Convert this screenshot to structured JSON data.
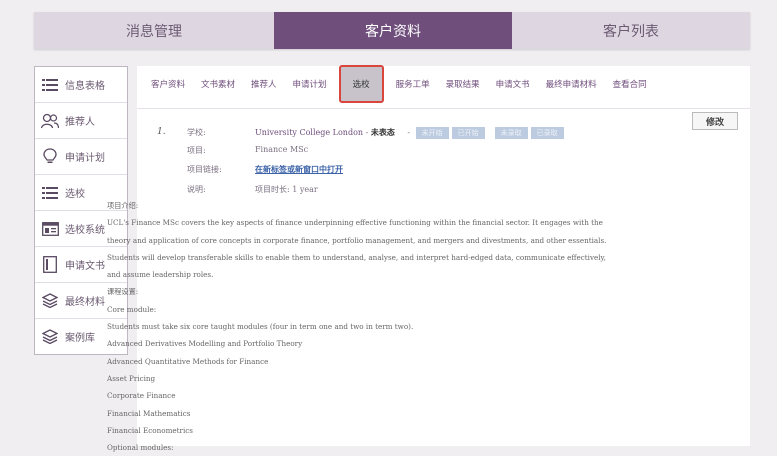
{
  "topnav": {
    "tabs": [
      "消息管理",
      "客户资料",
      "客户列表"
    ]
  },
  "sidebar": {
    "items": [
      {
        "label": "信息表格",
        "icon": "list-icon"
      },
      {
        "label": "推荐人",
        "icon": "users-icon"
      },
      {
        "label": "申请计划",
        "icon": "bulb-icon"
      },
      {
        "label": "选校",
        "icon": "list-icon"
      },
      {
        "label": "选校系统",
        "icon": "window-icon"
      },
      {
        "label": "申请文书",
        "icon": "document-icon"
      },
      {
        "label": "最终材料",
        "icon": "layers-icon"
      },
      {
        "label": "案例库",
        "icon": "layers-icon"
      }
    ]
  },
  "subtabs": [
    "客户资料",
    "文书素材",
    "推荐人",
    "申请计划",
    "选校",
    "服务工单",
    "录取结果",
    "申请文书",
    "最终申请材料",
    "查看合同"
  ],
  "edit_label": "修改",
  "record": {
    "num": "1.",
    "school_label": "学校:",
    "school_name": "University College London",
    "school_sep": " - ",
    "status_main": "未表态",
    "status_dash": "-",
    "chips": [
      "未开始",
      "已开始",
      "未录取",
      "已录取"
    ],
    "program_label": "项目:",
    "program": "Finance MSc",
    "link_label": "项目链接:",
    "link_text": "在新标签或新窗口中打开",
    "note_label": "说明:",
    "duration": "项目时长: 1 year"
  },
  "description": [
    "项目介绍:",
    "UCL's Finance MSc covers the key aspects of finance underpinning effective functioning within the financial sector. It engages with the",
    "theory and application of core concepts in corporate finance, portfolio management, and mergers and divestments, and other essentials.",
    "Students will develop transferable skills to enable them to understand, analyse, and interpret hard-edged data, communicate effectively,",
    "and assume leadership roles.",
    "课程设置:",
    "Core module:",
    "Students must take six core taught modules (four in term one and two in term two).",
    "Advanced Derivatives Modelling and Portfolio Theory",
    "Advanced Quantitative Methods for Finance",
    "Asset Pricing",
    "Corporate Finance",
    "Financial Mathematics",
    "Financial Econometrics",
    "Optional modules:"
  ],
  "colors": {
    "accent": "#6f4e7c",
    "nav_bg": "#ded7e2",
    "highlight_border": "#d9473c",
    "chip_bg": "#bccbe0",
    "link": "#3d63a8"
  }
}
